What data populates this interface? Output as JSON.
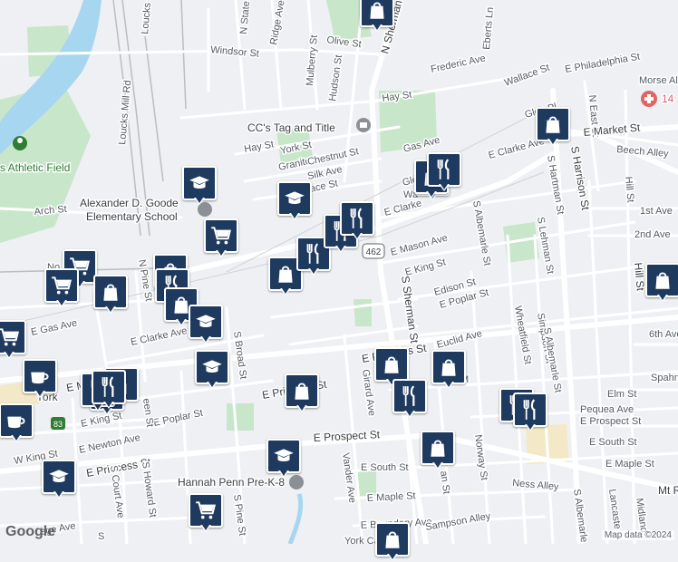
{
  "map": {
    "attribution": "Map data ©2024",
    "logo": "Google",
    "route_shield": "462",
    "hospital_number": "14",
    "colors": {
      "background": "#eef0f3",
      "road": "#ffffff",
      "park": "#c8e6c9",
      "water": "#a7d7f0",
      "marker": "#1f3a5f",
      "hospital": "#e06666",
      "landmark": "#8a9095"
    }
  },
  "places": {
    "athletic_field": "s Athletic Field",
    "school": "Alexander D. Goode Elementary School",
    "school_line1": "Alexander D. Goode",
    "school_line2": "Elementary School",
    "tag_title": "CC's Tag and Title",
    "pre_k": "Hannah Penn Pre-K-8"
  },
  "streets": [
    {
      "id": "olive-st",
      "name": "Olive St"
    },
    {
      "id": "n-sherman-st",
      "name": "N Sherman St"
    },
    {
      "id": "eberts-ln",
      "name": "Eberts Ln"
    },
    {
      "id": "windsor-st",
      "name": "Windsor St"
    },
    {
      "id": "n-state-st",
      "name": "N State St"
    },
    {
      "id": "ridge-ave",
      "name": "Ridge Ave"
    },
    {
      "id": "mulberry-st",
      "name": "Mulberry St"
    },
    {
      "id": "hudson-st",
      "name": "Hudson St"
    },
    {
      "id": "loucks-rd",
      "name": "Loucks"
    },
    {
      "id": "loucks-mill-rd",
      "name": "Loucks Mill Rd"
    },
    {
      "id": "frederic-ave",
      "name": "Frederic Ave"
    },
    {
      "id": "wallace-st",
      "name": "Wallace St"
    },
    {
      "id": "e-philadelphia-st",
      "name": "E Philadelphia St"
    },
    {
      "id": "morse-al",
      "name": "Morse Al"
    },
    {
      "id": "hay-st-1",
      "name": "Hay St"
    },
    {
      "id": "hay-st-2",
      "name": "Hay St"
    },
    {
      "id": "n-east-st",
      "name": "N East St"
    },
    {
      "id": "e-market-st",
      "name": "E Market St"
    },
    {
      "id": "beech-alley",
      "name": "Beech Alley"
    },
    {
      "id": "glen-pl-1",
      "name": "Glen Pl"
    },
    {
      "id": "glen-pl-2",
      "name": "Glen Pl"
    },
    {
      "id": "york-st",
      "name": "York St"
    },
    {
      "id": "granite-ave",
      "name": "Granite Ave"
    },
    {
      "id": "chestnut-st",
      "name": "Chestnut St"
    },
    {
      "id": "silk-ave",
      "name": "Silk Ave"
    },
    {
      "id": "wallace-st-2",
      "name": "allace St"
    },
    {
      "id": "gas-ave-1",
      "name": "Gas Ave"
    },
    {
      "id": "e-clarke-ave-1",
      "name": "E Clarke Ave"
    },
    {
      "id": "e-clarke-ave-2",
      "name": "E Clarke"
    },
    {
      "id": "e-clarke-ave-3",
      "name": "E Clarke Ave"
    },
    {
      "id": "wallace-st-3",
      "name": "Wa"
    },
    {
      "id": "arch-st",
      "name": "Arch St"
    },
    {
      "id": "s-albemarle-st-1",
      "name": "S Albemarle St"
    },
    {
      "id": "s-lehman-st",
      "name": "S Lehman St"
    },
    {
      "id": "s-hartman-st",
      "name": "S Hartman St"
    },
    {
      "id": "s-harrison-st",
      "name": "S Harrison St"
    },
    {
      "id": "hill-st-1",
      "name": "Hill St"
    },
    {
      "id": "hill-st-2",
      "name": "Hill St"
    },
    {
      "id": "first-ave",
      "name": "1st Ave"
    },
    {
      "id": "second-ave",
      "name": "2nd Ave"
    },
    {
      "id": "e-mason-ave",
      "name": "E Mason Ave"
    },
    {
      "id": "e-king-st-1",
      "name": "E King St"
    },
    {
      "id": "edison-st",
      "name": "Edison St"
    },
    {
      "id": "e-poplar-st-1",
      "name": "E Poplar St"
    },
    {
      "id": "n-pine-st",
      "name": "N Pine St"
    },
    {
      "id": "no-st",
      "name": "No"
    },
    {
      "id": "e-gas-ave",
      "name": "E Gas Ave"
    },
    {
      "id": "e-clarke-ave-4",
      "name": "E Clarke Ave"
    },
    {
      "id": "s-sherman-st",
      "name": "S Sherman St"
    },
    {
      "id": "euclid-ave",
      "name": "Euclid Ave"
    },
    {
      "id": "wheatfield-st",
      "name": "Wheatfield St"
    },
    {
      "id": "simpson-st",
      "name": "Simpson St"
    },
    {
      "id": "s-albemarle-st-2",
      "name": "S Albemarle St"
    },
    {
      "id": "sixth-ave",
      "name": "6th Ave"
    },
    {
      "id": "e-princess-st-1",
      "name": "E Princess St"
    },
    {
      "id": "e-princess-st-2",
      "name": "E Princess St"
    },
    {
      "id": "e-princess-st-3",
      "name": "E Princess St"
    },
    {
      "id": "girard-ave",
      "name": "Girard Ave"
    },
    {
      "id": "s-broad-st",
      "name": "S Broad St"
    },
    {
      "id": "spahn",
      "name": "Spahn"
    },
    {
      "id": "elm-st",
      "name": "Elm St"
    },
    {
      "id": "pequea-ave",
      "name": "Pequea Ave"
    },
    {
      "id": "e-prospect-st-1",
      "name": "E Prospect St"
    },
    {
      "id": "e-prospect-st-2",
      "name": "E Prospect St"
    },
    {
      "id": "e-south-st-1",
      "name": "E South St"
    },
    {
      "id": "e-south-st-2",
      "name": "E South St"
    },
    {
      "id": "e-maple-st-1",
      "name": "E Maple St"
    },
    {
      "id": "e-maple-st-2",
      "name": "E Maple St"
    },
    {
      "id": "e-boundary-ave",
      "name": "E Boundary Ave"
    },
    {
      "id": "sampson-alley",
      "name": "Sampson Alley"
    },
    {
      "id": "ness-alley",
      "name": "Ness Alley"
    },
    {
      "id": "norway-st",
      "name": "Norway St"
    },
    {
      "id": "vander-ave",
      "name": "Vander Ave"
    },
    {
      "id": "e-king-st-2",
      "name": "E King St"
    },
    {
      "id": "w-king-st",
      "name": "W King St"
    },
    {
      "id": "e-newton-ave",
      "name": "E Newton Ave"
    },
    {
      "id": "e-poplar-st-2",
      "name": "E Poplar St"
    },
    {
      "id": "s-court-ave",
      "name": "S Court Ave"
    },
    {
      "id": "s-howard-st",
      "name": "S Howard St"
    },
    {
      "id": "s-pine-st",
      "name": "S Pine St"
    },
    {
      "id": "een-st",
      "name": "een St"
    },
    {
      "id": "e-ma-st",
      "name": "E Ma"
    },
    {
      "id": "york",
      "name": "York"
    },
    {
      "id": "midland",
      "name": "Midland"
    },
    {
      "id": "mt-r",
      "name": "Mt R"
    },
    {
      "id": "lancaster",
      "name": "Lancaste"
    },
    {
      "id": "s-albemarle-st-3",
      "name": "S Albemarle St"
    },
    {
      "id": "an-st",
      "name": "an St"
    },
    {
      "id": "college-ave",
      "name": "ege Ave"
    },
    {
      "id": "sa-st",
      "name": "S"
    },
    {
      "id": "york-cath",
      "name": "York Cath"
    },
    {
      "id": "m-label",
      "name": "M"
    },
    {
      "id": "hwy-83",
      "name": "83"
    }
  ],
  "markers": [
    {
      "id": "m1",
      "icon": "shopping-bag"
    },
    {
      "id": "m2",
      "icon": "graduation-cap"
    },
    {
      "id": "m3",
      "icon": "graduation-cap"
    },
    {
      "id": "m4",
      "icon": "shopping-cart"
    },
    {
      "id": "m5",
      "icon": "shopping-cart"
    },
    {
      "id": "m6",
      "icon": "shopping-cart"
    },
    {
      "id": "m7",
      "icon": "shopping-bag"
    },
    {
      "id": "m8",
      "icon": "shopping-bag"
    },
    {
      "id": "m9",
      "icon": "restaurant"
    },
    {
      "id": "m10",
      "icon": "shopping-bag"
    },
    {
      "id": "m11",
      "icon": "graduation-cap"
    },
    {
      "id": "m12",
      "icon": "shopping-cart"
    },
    {
      "id": "m13",
      "icon": "shopping-bag"
    },
    {
      "id": "m14",
      "icon": "restaurant"
    },
    {
      "id": "m15",
      "icon": "restaurant"
    },
    {
      "id": "m16",
      "icon": "restaurant"
    },
    {
      "id": "m17",
      "icon": "restaurant"
    },
    {
      "id": "m18",
      "icon": "shopping-bag"
    },
    {
      "id": "m19",
      "icon": "restaurant"
    },
    {
      "id": "m20",
      "icon": "restaurant"
    },
    {
      "id": "m21",
      "icon": "shopping-bag"
    },
    {
      "id": "m22",
      "icon": "restaurant"
    },
    {
      "id": "m23",
      "icon": "coffee"
    },
    {
      "id": "m24",
      "icon": "coffee"
    },
    {
      "id": "m25",
      "icon": "restaurant"
    },
    {
      "id": "m26",
      "icon": "graduation-cap"
    },
    {
      "id": "m27",
      "icon": "shopping-bag"
    },
    {
      "id": "m28",
      "icon": "shopping-bag"
    },
    {
      "id": "m29",
      "icon": "shopping-bag"
    },
    {
      "id": "m30",
      "icon": "restaurant"
    },
    {
      "id": "m31",
      "icon": "restaurant"
    },
    {
      "id": "m32",
      "icon": "restaurant"
    },
    {
      "id": "m33",
      "icon": "shopping-bag"
    },
    {
      "id": "m34",
      "icon": "graduation-cap"
    },
    {
      "id": "m35",
      "icon": "graduation-cap"
    },
    {
      "id": "m36",
      "icon": "shopping-cart"
    },
    {
      "id": "m37",
      "icon": "shopping-bag"
    },
    {
      "id": "m38",
      "icon": "shopping-bag"
    },
    {
      "id": "m39",
      "icon": "shopping-bag"
    }
  ]
}
